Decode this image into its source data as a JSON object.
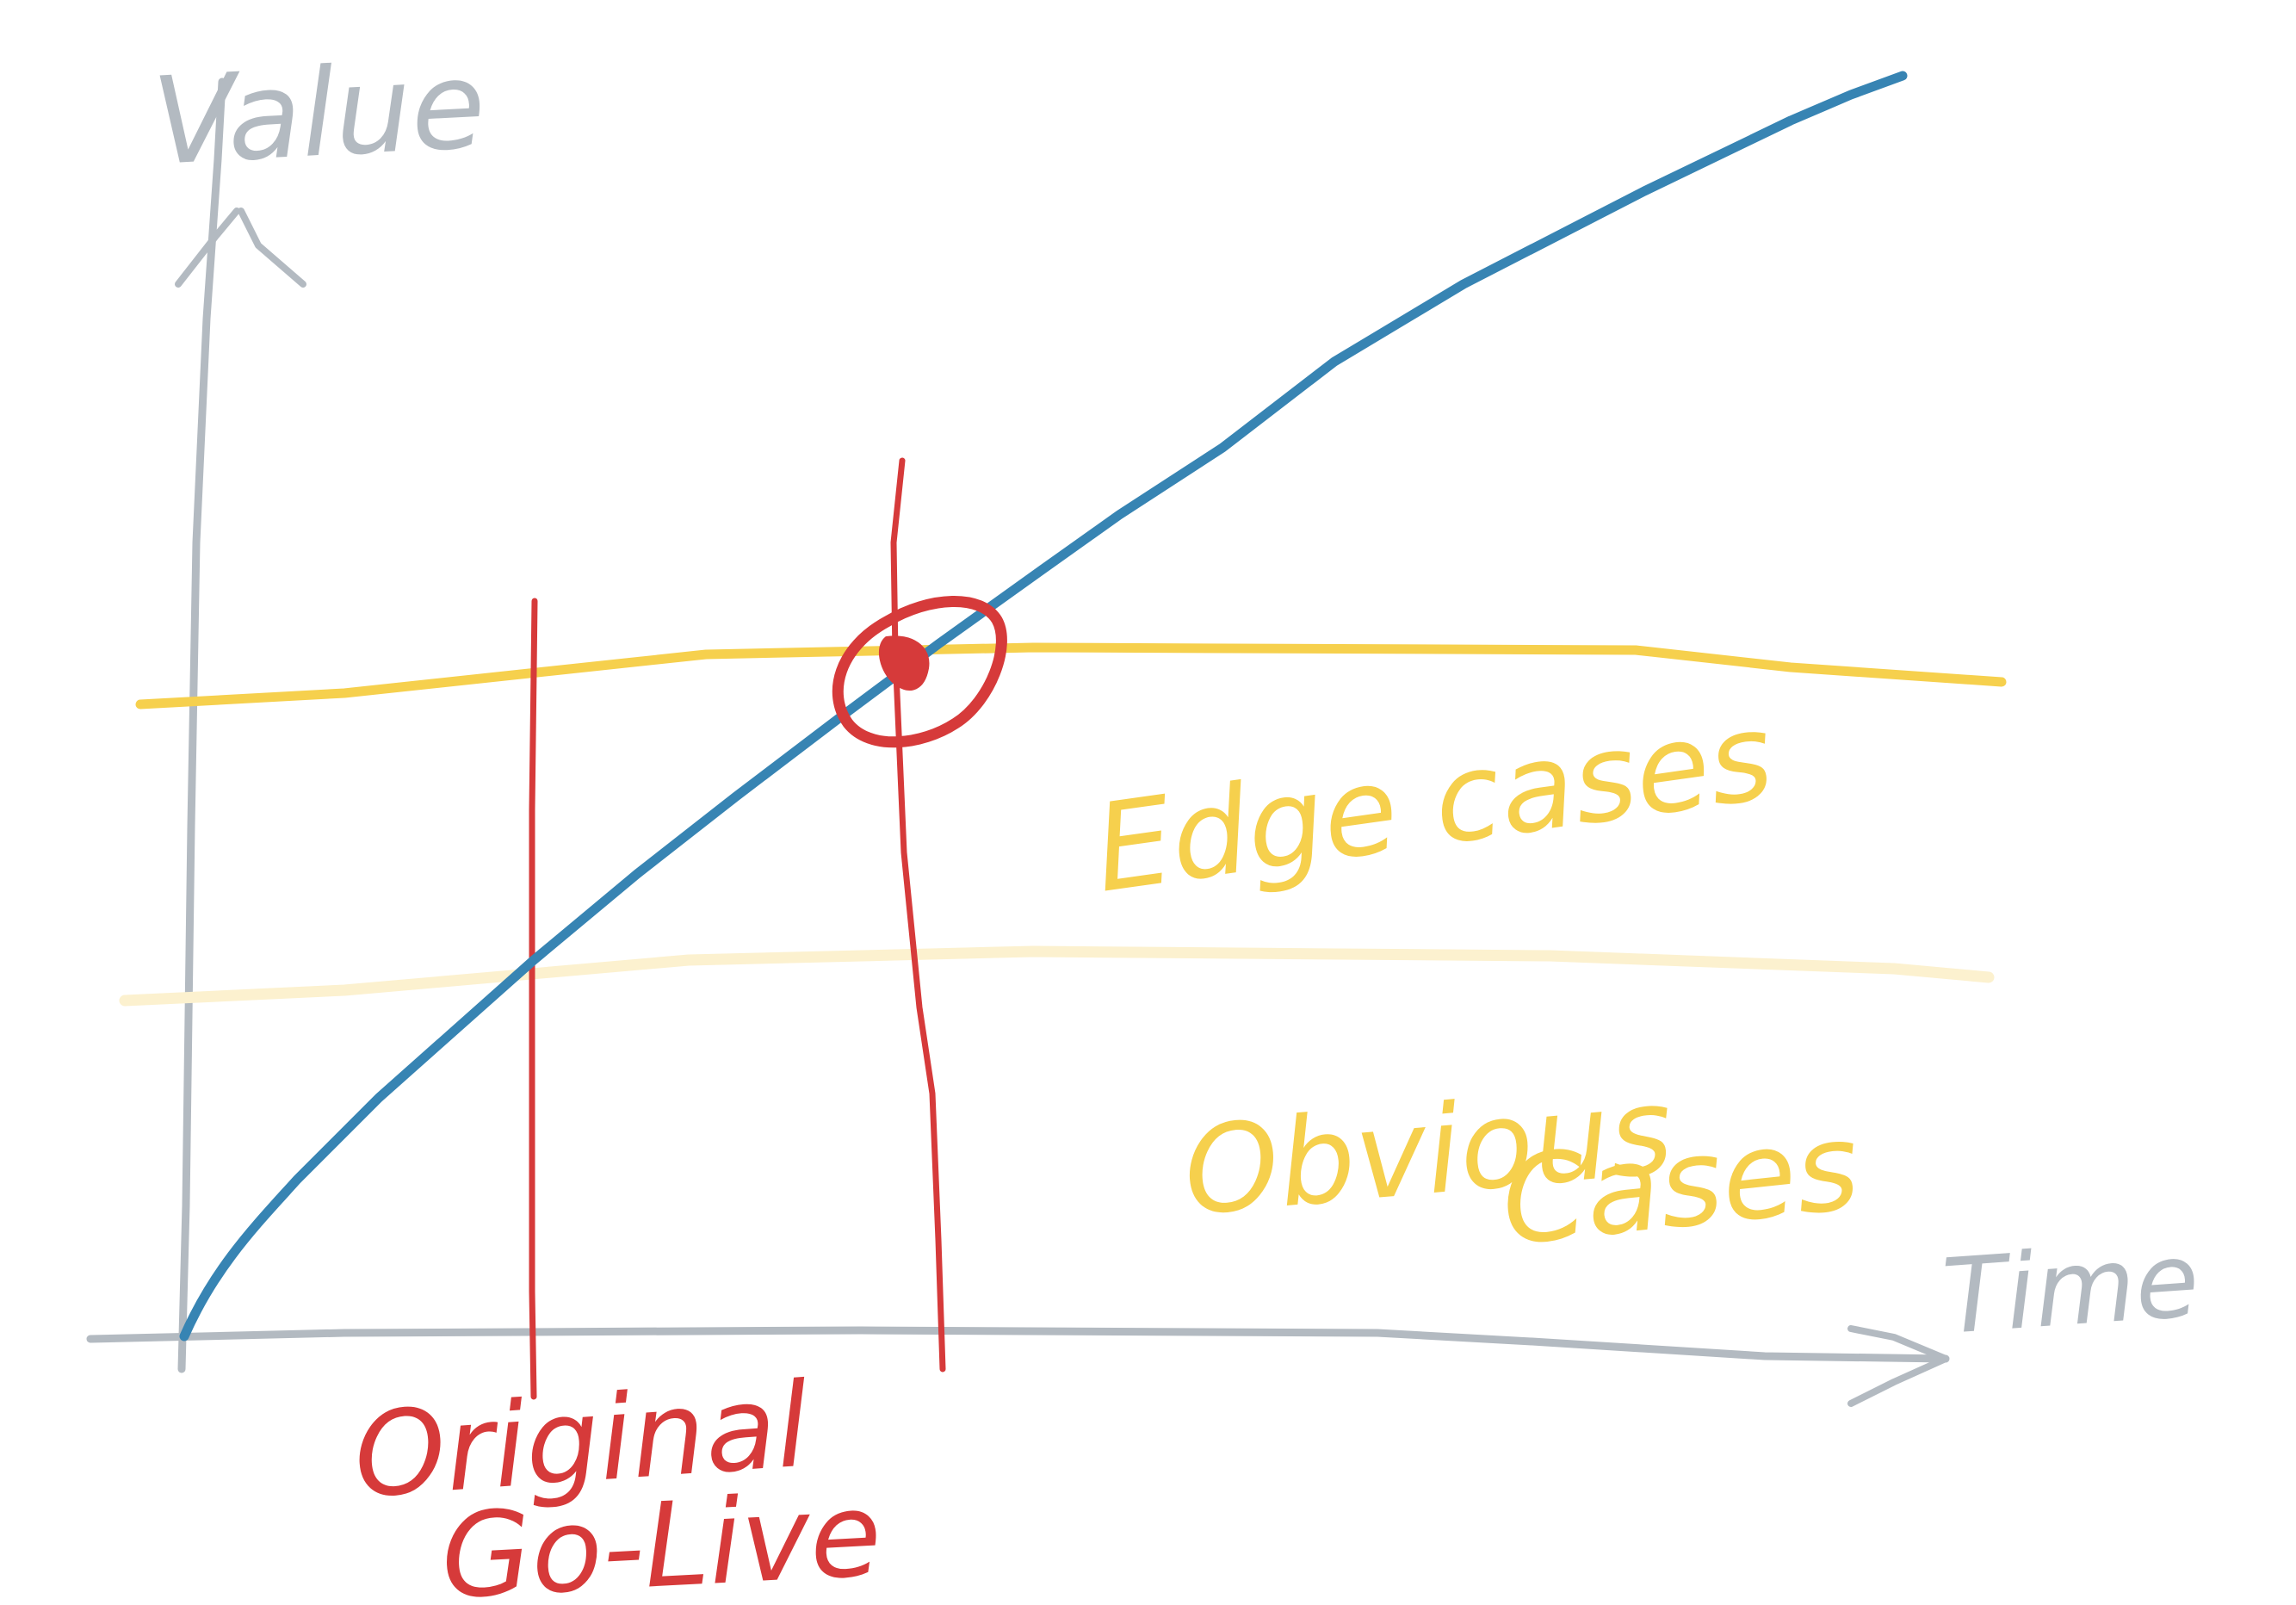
{
  "axes": {
    "y_label": "Value",
    "x_label": "Time",
    "color": "#b3bac1"
  },
  "bands": {
    "upper_label": "Edge cases",
    "lower_label": "Obvious Cases",
    "upper_color": "#f6d04d",
    "lower_color": "#fcf1cf",
    "label_color": "#f6d04d"
  },
  "curve": {
    "color": "#3784b3"
  },
  "markers": {
    "go_live_label_line1": "Original",
    "go_live_label_line2": "Go-Live",
    "color": "#d63a3a"
  }
}
